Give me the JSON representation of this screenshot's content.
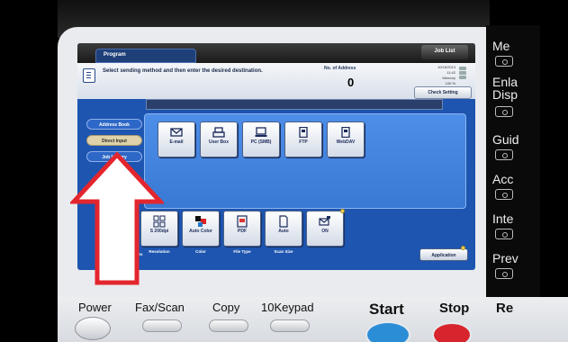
{
  "screen": {
    "program_tab": "Program",
    "job_list_button": "Job List",
    "instruction": "Select sending method and then enter the desired destination.",
    "address_label": "No. of Address",
    "address_count": "0",
    "datetime_lines": [
      "10/18/2013",
      "11:42",
      "Memory",
      "100 %"
    ],
    "check_setting_button": "Check Setting",
    "side_tabs": [
      "Address Book",
      "Direct Input",
      "Job History"
    ],
    "send_methods": [
      {
        "label": "E-mail",
        "icon": "envelope-icon"
      },
      {
        "label": "User Box",
        "icon": "user-box-icon"
      },
      {
        "label": "PC (SMB)",
        "icon": "pc-icon"
      },
      {
        "label": "FTP",
        "icon": "ftp-icon"
      },
      {
        "label": "WebDAV",
        "icon": "webdav-icon"
      }
    ],
    "settings": [
      {
        "value": "S 200dpi",
        "caption": "Resolution",
        "icon": "resolution-icon"
      },
      {
        "value": "Auto Color",
        "caption": "Color",
        "icon": "color-icon"
      },
      {
        "value": "PDF",
        "caption": "File Type",
        "icon": "file-type-icon"
      },
      {
        "value": "Auto",
        "caption": "Scan Size",
        "icon": "scan-size-icon"
      },
      {
        "value": "ON",
        "caption": "",
        "icon": "email-notification-icon"
      }
    ],
    "left_caption": "Duplex",
    "application_button": "Application"
  },
  "hardware": {
    "power": "Power",
    "fax_scan": "Fax/Scan",
    "copy": "Copy",
    "keypad": "10Keypad",
    "start": "Start",
    "stop": "Stop",
    "reset_partial": "Re"
  },
  "side_panel": {
    "labels": [
      "Me",
      "Enla",
      "Disp",
      "Guid",
      "Acc",
      "Inte",
      "Prev"
    ]
  },
  "colors": {
    "screen_blue": "#1d55b0",
    "panel_blue": "#3979d4",
    "arrow_red": "#e3262e",
    "start_blue": "#2c8dd7",
    "stop_red": "#d8242c"
  }
}
